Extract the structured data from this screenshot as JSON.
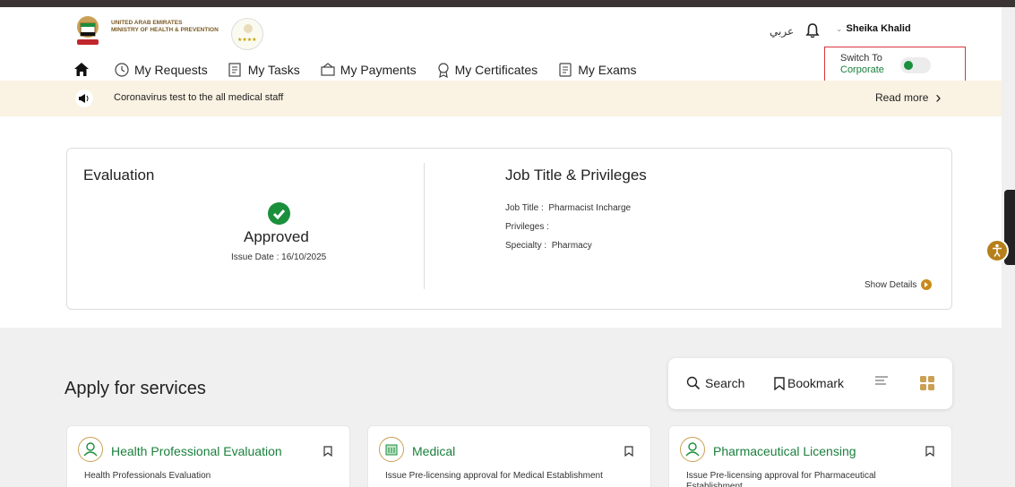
{
  "header": {
    "ministry_line1": "UNITED ARAB EMIRATES",
    "ministry_line2": "MINISTRY OF HEALTH & PREVENTION",
    "language_label": "عربي",
    "user_name": "Sheika Khalid"
  },
  "nav": {
    "items": [
      {
        "label": "My Requests",
        "icon": "requests-icon"
      },
      {
        "label": "My Tasks",
        "icon": "tasks-icon"
      },
      {
        "label": "My Payments",
        "icon": "payments-icon"
      },
      {
        "label": "My Certificates",
        "icon": "certificate-icon"
      },
      {
        "label": "My Exams",
        "icon": "exams-icon"
      }
    ]
  },
  "switch": {
    "label": "Switch To",
    "target": "Corporate"
  },
  "announcement": {
    "text": "Coronavirus test to the all medical staff",
    "read_more": "Read more"
  },
  "evaluation": {
    "title": "Evaluation",
    "status": "Approved",
    "issue_date": "Issue Date : 16/10/2025"
  },
  "job": {
    "title": "Job Title & Privileges",
    "rows": [
      {
        "label": "Job Title :",
        "value": "Pharmacist Incharge"
      },
      {
        "label": "Privileges :",
        "value": ""
      },
      {
        "label": "Specialty :",
        "value": "Pharmacy"
      }
    ],
    "show_details": "Show Details"
  },
  "services": {
    "title": "Apply for services",
    "search_label": "Search",
    "bookmark_label": "Bookmark",
    "cards": [
      {
        "title": "Health Professional Evaluation",
        "desc": "Health Professionals Evaluation"
      },
      {
        "title": "Medical",
        "desc": "Issue Pre-licensing approval for Medical Establishment"
      },
      {
        "title": "Pharmaceutical Licensing",
        "desc": "Issue Pre-licensing approval for Pharmaceutical Establishment"
      }
    ]
  },
  "colors": {
    "accent_green": "#1a8f3c",
    "accent_gold": "#c9a055",
    "highlight_red": "#d9363e"
  }
}
